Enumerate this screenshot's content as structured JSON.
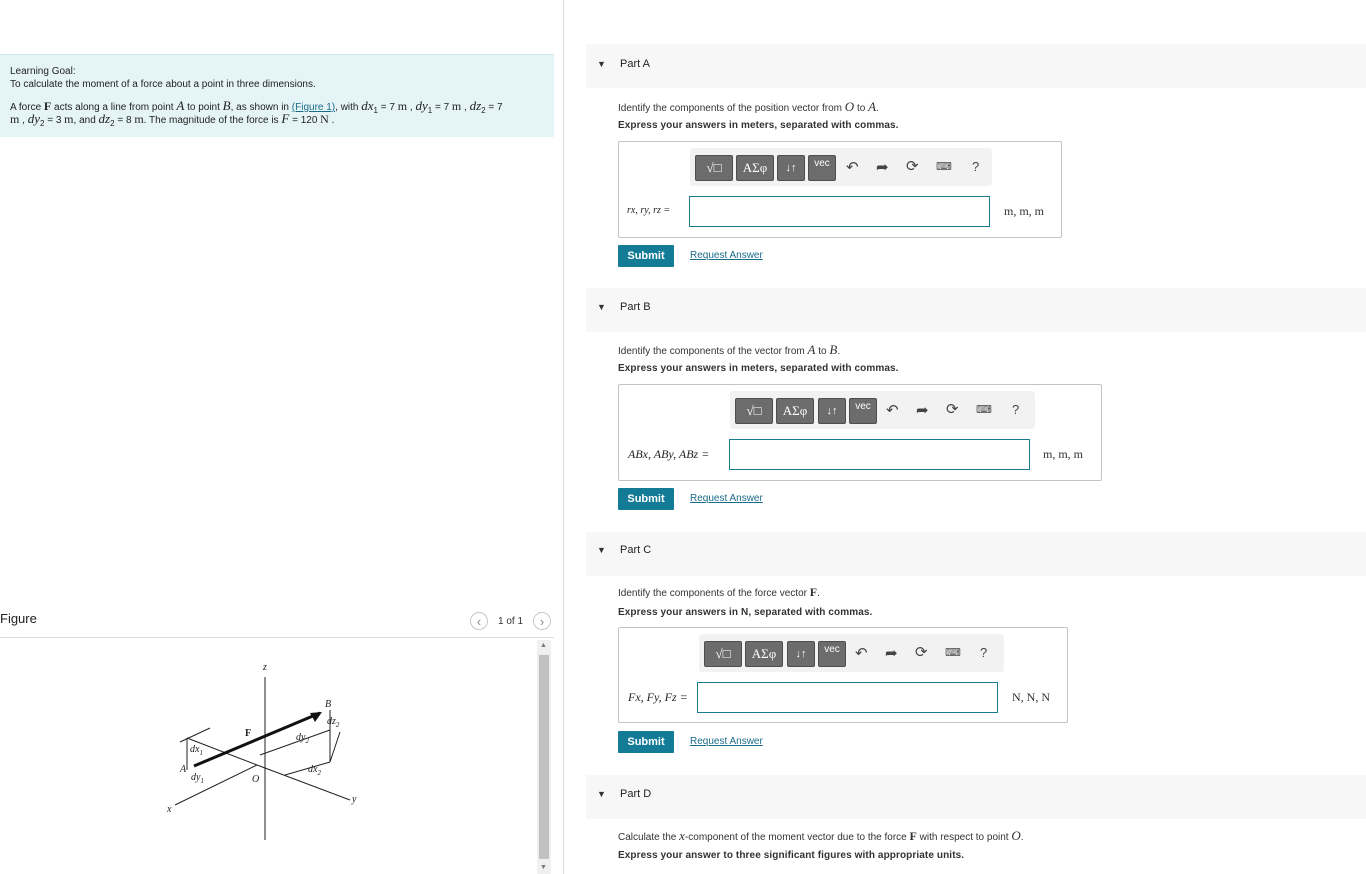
{
  "learning_goal": {
    "heading": "Learning Goal:",
    "subtitle": "To calculate the moment of a force about a point in three dimensions.",
    "p1": "A force",
    "F": "F",
    "p2": "acts along a line from point",
    "A": "A",
    "p3": "to point",
    "B": "B",
    "p4": ", as shown in",
    "figure_link": "(Figure 1)",
    "p5": ", with",
    "dx1": "dx",
    "dx1_sub": "1",
    "dx1_val": "= 7",
    "m": "m",
    "dy1": "dy",
    "dy1_sub": "1",
    "dy1_val": "= 7",
    "dz2": "dz",
    "dz2_sub": "2",
    "dz2_val": "= 7",
    "line2_m": "m",
    "dy2": "dy",
    "dy2_sub": "2",
    "dy2_val": "= 3",
    "dz2b": "dz",
    "dz2b_sub": "2",
    "dz2b_val": "= 8",
    "mag_text": ". The magnitude of the force is",
    "F_sym": "F",
    "F_val": "= 120",
    "N": "N",
    "and": ", and"
  },
  "figure": {
    "title": "Figure",
    "pager": "1 of 1",
    "prev_icon": "chevron-left-icon",
    "next_icon": "chevron-right-icon",
    "labels": {
      "z": "z",
      "B": "B",
      "dz2": "dz",
      "dz2_sub": "2",
      "F": "F",
      "dy2": "dy",
      "dy2_sub": "2",
      "dx1": "dx",
      "dx1_sub": "1",
      "A": "A",
      "dy1": "dy",
      "dy1_sub": "1",
      "O": "O",
      "dx2": "dx",
      "dx2_sub": "2",
      "y": "y",
      "x": "x"
    }
  },
  "parts": [
    {
      "title": "Part A",
      "instruction_pre": "Identify the components of the position vector from",
      "sym1": "O",
      "mid": "to",
      "sym2": "A",
      "instruction_post": ".",
      "express": "Express your answers in meters, separated with commas.",
      "answer_label": "rx, ry, rz =",
      "units": "m, m, m",
      "submit": "Submit",
      "request": "Request Answer"
    },
    {
      "title": "Part B",
      "instruction_pre": "Identify the components of the vector from",
      "sym1": "A",
      "mid": "to",
      "sym2": "B",
      "instruction_post": ".",
      "express": "Express your answers in meters, separated with commas.",
      "answer_label": "ABx, ABy, ABz =",
      "units": "m, m, m",
      "submit": "Submit",
      "request": "Request Answer"
    },
    {
      "title": "Part C",
      "instruction_pre": "Identify the components of the force vector",
      "sym1": "F",
      "instruction_post": ".",
      "express": "Express your answers in N, separated with commas.",
      "answer_label": "Fx, Fy, Fz =",
      "units": "N, N, N",
      "submit": "Submit",
      "request": "Request Answer"
    },
    {
      "title": "Part D",
      "instruction_pre": "Calculate the",
      "sym1": "x",
      "mid": "-component of the moment vector due to the force",
      "sym2": "F",
      "mid2": "with respect to point",
      "sym3": "O",
      "instruction_post": ".",
      "express": "Express your answer to three significant figures with appropriate units."
    }
  ],
  "toolbar": {
    "templates": "√□",
    "greek": "ΑΣφ",
    "arrows": "↓↑",
    "vec": "vec",
    "help": "?",
    "icons": [
      "undo-icon",
      "redo-icon",
      "reset-icon",
      "keyboard-icon"
    ]
  },
  "colors": {
    "accent": "#147b96",
    "goal_bg": "#e5f5f7",
    "part_header_bg": "#f7f7f7"
  }
}
